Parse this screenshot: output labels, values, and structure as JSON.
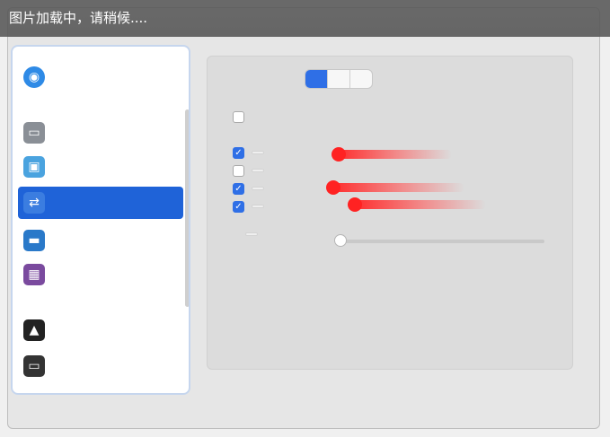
{
  "loading_banner": "图片加载中，请稍候....",
  "window": {
    "title": ""
  },
  "sidebar": {
    "items": [
      {
        "label": "",
        "icon": "globe-icon",
        "color": "#2e8ae6"
      },
      {
        "label": "",
        "icon": "hard-drive-icon",
        "color": "#8a8f96"
      },
      {
        "label": "",
        "icon": "display-icon",
        "color": "#4aa3df"
      },
      {
        "label": "",
        "icon": "network-icon",
        "color": "#3b7de0",
        "selected": true
      },
      {
        "label": "",
        "icon": "folder-icon",
        "color": "#2a79c9"
      },
      {
        "label": "",
        "icon": "usb-icon",
        "color": "#7a4a9e"
      },
      {
        "label": "",
        "icon": "user-icon",
        "color": "#222222"
      },
      {
        "label": "",
        "icon": "device-icon",
        "color": "#333333"
      }
    ],
    "footer": ""
  },
  "main": {
    "tabs": [
      {
        "label": "",
        "active": true
      },
      {
        "label": ""
      },
      {
        "label": ""
      }
    ],
    "checkboxes": [
      {
        "label": "",
        "checked": false
      },
      {
        "label": "",
        "checked": true
      },
      {
        "label": "",
        "checked": false
      },
      {
        "label": "",
        "checked": true
      },
      {
        "label": "",
        "checked": true
      }
    ],
    "slider": {
      "label": "",
      "min_label": "",
      "max_label": ""
    }
  },
  "colors": {
    "accent": "#1f63d8",
    "annotation_red": "#ff2222"
  }
}
